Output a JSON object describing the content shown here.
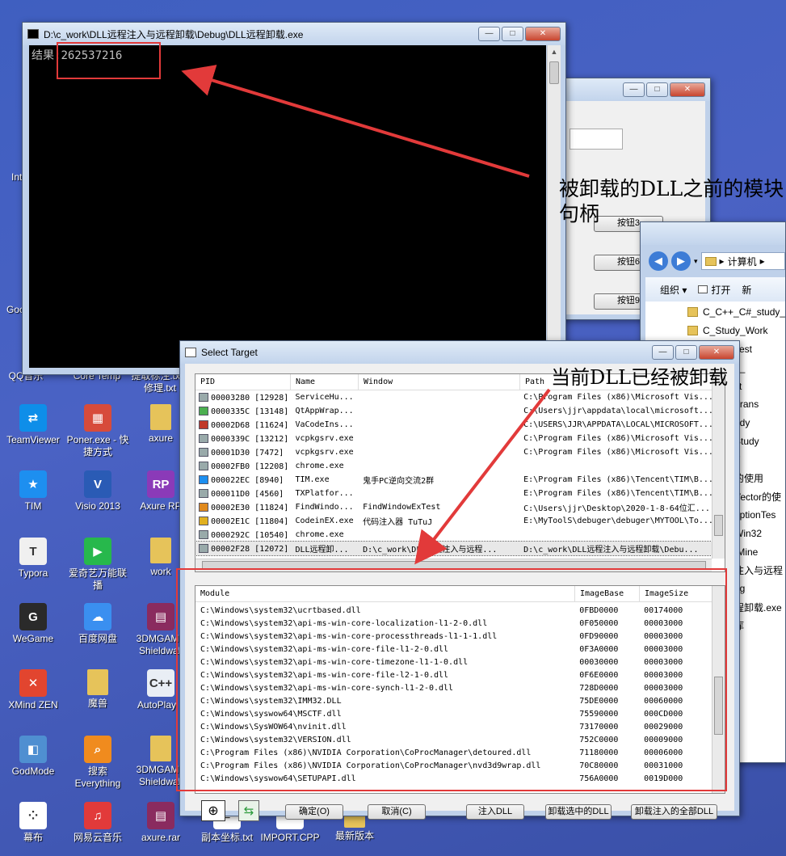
{
  "desktop_icons": [
    {
      "label": "TeamViewer",
      "icon": "teamviewer-icon",
      "color": "#0e8ee9"
    },
    {
      "label": "Poner.exe - 快捷方式",
      "icon": "poner-icon",
      "color": "#d74b3b"
    },
    {
      "label": "axure",
      "icon": "folder-icon",
      "color": "#e6c35a"
    },
    {
      "label": "TIM",
      "icon": "tim-icon",
      "color": "#1d8ff0"
    },
    {
      "label": "Visio 2013",
      "icon": "visio-icon",
      "color": "#2a5bb5"
    },
    {
      "label": "Axure RP",
      "icon": "axure-icon",
      "color": "#8b3ab8"
    },
    {
      "label": "Typora",
      "icon": "typora-icon",
      "color": "#f0f0f0"
    },
    {
      "label": "爱奇艺万能联播",
      "icon": "iqiyi-icon",
      "color": "#27b84c"
    },
    {
      "label": "work",
      "icon": "folder-icon",
      "color": "#e6c35a"
    },
    {
      "label": "WeGame",
      "icon": "wegame-icon",
      "color": "#2a2a2a"
    },
    {
      "label": "百度网盘",
      "icon": "baidu-netdisk-icon",
      "color": "#3a8ff0"
    },
    {
      "label": "3DMGAME Shieldwall",
      "icon": "winrar-icon",
      "color": "#8a2b5f"
    },
    {
      "label": "XMind ZEN",
      "icon": "xmind-icon",
      "color": "#e2452f"
    },
    {
      "label": "魔兽",
      "icon": "folder-icon",
      "color": "#e6c35a"
    },
    {
      "label": "AutoPlay p",
      "icon": "cpp-icon",
      "color": "#e9eef5"
    },
    {
      "label": "GodMode",
      "icon": "godmode-icon",
      "color": "#4f8fd1"
    },
    {
      "label": "搜索 Everything",
      "icon": "everything-icon",
      "color": "#f08b1e"
    },
    {
      "label": "3DMGAME Shieldwall",
      "icon": "folder-icon",
      "color": "#e6c35a"
    },
    {
      "label": "幕布",
      "icon": "mubu-icon",
      "color": "#ffffff"
    },
    {
      "label": "网易云音乐",
      "icon": "netease-music-icon",
      "color": "#e23a3a"
    },
    {
      "label": "axure.rar",
      "icon": "winrar-icon",
      "color": "#8a2b5f"
    },
    {
      "label": "副本坐标.txt",
      "icon": "txt-icon",
      "color": "#ffffff"
    },
    {
      "label": "IMPORT.CPP",
      "icon": "cpp-file-icon",
      "color": "#ffffff"
    },
    {
      "label": "最新版本",
      "icon": "folder-icon",
      "color": "#e6c35a"
    }
  ],
  "desktop_partial": [
    "Inte",
    "Goc",
    "QQ音乐",
    "Core Temp",
    "提取标注.txt -修理.txt"
  ],
  "console": {
    "title": "D:\\c_work\\DLL远程注入与远程卸载\\Debug\\DLL远程卸载.exe",
    "output_label": "结果:",
    "output_value": "262537216"
  },
  "back_window": {
    "buttons": [
      "按钮3",
      "按钮6",
      "按钮9"
    ]
  },
  "explorer": {
    "breadcrumb": "计算机",
    "toolbar": [
      "组织 ▾",
      "打开",
      "新"
    ],
    "items": [
      "C_C++_C#_study_",
      "C_Study_Work",
      "Test",
      "1_",
      "ct",
      "Trans",
      "udy",
      "Study",
      "T",
      "的使用",
      "Vector的使",
      "eptionTes",
      "Win32",
      "tMine",
      "注入与远程",
      "ug",
      "程卸载.exe",
      "库"
    ]
  },
  "select_target": {
    "title": "Select Target",
    "process_columns": [
      "PID",
      "Name",
      "Window",
      "Path"
    ],
    "processes": [
      {
        "pid": "00003280 [12928]",
        "name": "ServiceHu...",
        "window": "",
        "path": "C:\\Program Files (x86)\\Microsoft Vis..."
      },
      {
        "pid": "0000335C [13148]",
        "name": "QtAppWrap...",
        "window": "",
        "path": "C:\\Users\\jjr\\appdata\\local\\microsoft..."
      },
      {
        "pid": "00002D68 [11624]",
        "name": "VaCodeIns...",
        "window": "",
        "path": "C:\\USERS\\JJR\\APPDATA\\LOCAL\\MICROSOFT..."
      },
      {
        "pid": "0000339C [13212]",
        "name": "vcpkgsrv.exe",
        "window": "",
        "path": "C:\\Program Files (x86)\\Microsoft Vis..."
      },
      {
        "pid": "00001D30 [7472]",
        "name": "vcpkgsrv.exe",
        "window": "",
        "path": "C:\\Program Files (x86)\\Microsoft Vis..."
      },
      {
        "pid": "00002FB0 [12208]",
        "name": "chrome.exe",
        "window": "",
        "path": ""
      },
      {
        "pid": "000022EC [8940]",
        "name": "TIM.exe",
        "window": "鬼手PC逆向交流2群",
        "path": "E:\\Program Files (x86)\\Tencent\\TIM\\B..."
      },
      {
        "pid": "000011D0 [4560]",
        "name": "TXPlatfor...",
        "window": "",
        "path": "E:\\Program Files (x86)\\Tencent\\TIM\\B..."
      },
      {
        "pid": "00002E30 [11824]",
        "name": "FindWindo...",
        "window": "FindWindowExTest",
        "path": "C:\\Users\\jjr\\Desktop\\2020-1-8-64位汇..."
      },
      {
        "pid": "00002E1C [11804]",
        "name": "CodeinEX.exe",
        "window": "代码注入器 TuTuJ",
        "path": "E:\\MyToolS\\debuger\\debuger\\MYTOOL\\To..."
      },
      {
        "pid": "0000292C [10540]",
        "name": "chrome.exe",
        "window": "",
        "path": ""
      },
      {
        "pid": "00002F28 [12072]",
        "name": "DLL远程卸...",
        "window": "D:\\c_work\\DLL远程注入与远程...",
        "path": "D:\\c_work\\DLL远程注入与远程卸载\\Debu..."
      }
    ],
    "module_columns": [
      "Module",
      "ImageBase",
      "ImageSize"
    ],
    "modules": [
      {
        "module": "C:\\Windows\\system32\\ucrtbased.dll",
        "base": "0FBD0000",
        "size": "00174000"
      },
      {
        "module": "C:\\Windows\\system32\\api-ms-win-core-localization-l1-2-0.dll",
        "base": "0F050000",
        "size": "00003000"
      },
      {
        "module": "C:\\Windows\\system32\\api-ms-win-core-processthreads-l1-1-1.dll",
        "base": "0FD90000",
        "size": "00003000"
      },
      {
        "module": "C:\\Windows\\system32\\api-ms-win-core-file-l1-2-0.dll",
        "base": "0F3A0000",
        "size": "00003000"
      },
      {
        "module": "C:\\Windows\\system32\\api-ms-win-core-timezone-l1-1-0.dll",
        "base": "00030000",
        "size": "00003000"
      },
      {
        "module": "C:\\Windows\\system32\\api-ms-win-core-file-l2-1-0.dll",
        "base": "0F6E0000",
        "size": "00003000"
      },
      {
        "module": "C:\\Windows\\system32\\api-ms-win-core-synch-l1-2-0.dll",
        "base": "728D0000",
        "size": "00003000"
      },
      {
        "module": "C:\\Windows\\system32\\IMM32.DLL",
        "base": "75DE0000",
        "size": "00060000"
      },
      {
        "module": "C:\\Windows\\syswow64\\MSCTF.dll",
        "base": "75590000",
        "size": "000CD000"
      },
      {
        "module": "C:\\Windows\\SysWOW64\\nvinit.dll",
        "base": "73170000",
        "size": "00029000"
      },
      {
        "module": "C:\\Windows\\system32\\VERSION.dll",
        "base": "752C0000",
        "size": "00009000"
      },
      {
        "module": "C:\\Program Files (x86)\\NVIDIA Corporation\\CoProcManager\\detoured.dll",
        "base": "71180000",
        "size": "00006000"
      },
      {
        "module": "C:\\Program Files (x86)\\NVIDIA Corporation\\CoProcManager\\nvd3d9wrap.dll",
        "base": "70C80000",
        "size": "00031000"
      },
      {
        "module": "C:\\Windows\\syswow64\\SETUPAPI.dll",
        "base": "756A0000",
        "size": "0019D000"
      }
    ],
    "buttons": {
      "ok": "确定(O)",
      "cancel": "取消(C)",
      "inject": "注入DLL",
      "unload_selected": "卸载选中的DLL",
      "unload_all": "卸载注入的全部DLL"
    }
  },
  "annotations": {
    "handle_note": "被卸载的DLL之前的模块句柄",
    "unloaded_note": "当前DLL已经被卸载",
    "accent": "#e23a3a"
  }
}
